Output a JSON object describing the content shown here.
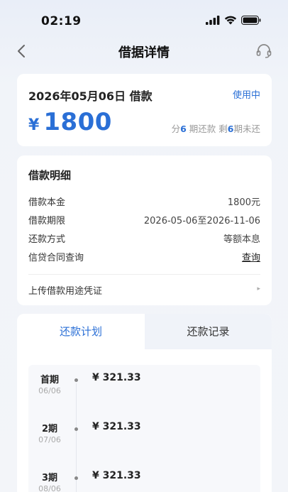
{
  "status_bar": {
    "time": "02:19"
  },
  "nav": {
    "title": "借据详情"
  },
  "summary": {
    "date_title": "2026年05月06日 借款",
    "status": "使用中",
    "currency": "¥",
    "amount": "1800",
    "periods_prefix": "分",
    "periods_total": "6",
    "periods_mid": " 期还款 剩",
    "periods_remaining": "6",
    "periods_suffix": "期未还"
  },
  "details": {
    "title": "借款明细",
    "rows": [
      {
        "label": "借款本金",
        "value": "1800元"
      },
      {
        "label": "借款期限",
        "value": "2026-05-06至2026-11-06"
      },
      {
        "label": "还款方式",
        "value": "等额本息"
      },
      {
        "label": "信贷合同查询",
        "value": "查询"
      }
    ],
    "upload_label": "上传借款用途凭证"
  },
  "tabs": [
    {
      "label": "还款计划",
      "active": true
    },
    {
      "label": "还款记录",
      "active": false
    }
  ],
  "schedule": [
    {
      "period": "首期",
      "date": "06/06",
      "amount": "¥ 321.33"
    },
    {
      "period": "2期",
      "date": "07/06",
      "amount": "¥ 321.33"
    },
    {
      "period": "3期",
      "date": "08/06",
      "amount": "¥ 321.33"
    }
  ],
  "colors": {
    "accent": "#2a6fd6",
    "text": "#222222",
    "muted": "#999999"
  },
  "icons": {
    "back": "chevron-left-icon",
    "service": "headset-icon",
    "signal": "signal-icon",
    "wifi": "wifi-icon",
    "battery": "battery-icon",
    "arrow": "chevron-right-icon"
  }
}
